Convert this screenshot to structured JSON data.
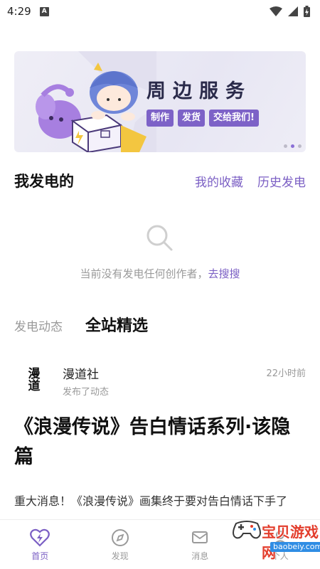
{
  "status_bar": {
    "time": "4:29",
    "badge": "A"
  },
  "banner": {
    "title": "周边服务",
    "tags": [
      "制作",
      "发货",
      "交给我们!"
    ],
    "page_count": 3,
    "active_page": 2
  },
  "section": {
    "title": "我发电的",
    "links": [
      "我的收藏",
      "历史发电"
    ]
  },
  "empty_state": {
    "text": "当前没有发电任何创作者，",
    "link": "去搜搜"
  },
  "tabs": [
    {
      "label": "发电动态",
      "active": false
    },
    {
      "label": "全站精选",
      "active": true
    }
  ],
  "post": {
    "avatar_text": "漫道",
    "author": "漫道社",
    "subtitle": "发布了动态",
    "time": "22小时前",
    "title": "《浪漫传说》告白情话系列·该隐篇",
    "body": "重大消息！《浪漫传说》画集终于要对告白情话下手了"
  },
  "nav": [
    {
      "label": "首页",
      "icon": "lightning-heart-icon",
      "active": true
    },
    {
      "label": "发现",
      "icon": "compass-icon",
      "active": false
    },
    {
      "label": "消息",
      "icon": "message-icon",
      "active": false
    },
    {
      "label": "个人",
      "icon": "person-icon",
      "active": false
    }
  ],
  "watermark": {
    "title": "宝贝游戏网",
    "url": "baobeiy.com"
  },
  "colors": {
    "accent": "#7b5fc4",
    "tag_bg": "#7d62c7",
    "muted": "#9a9a9a"
  }
}
